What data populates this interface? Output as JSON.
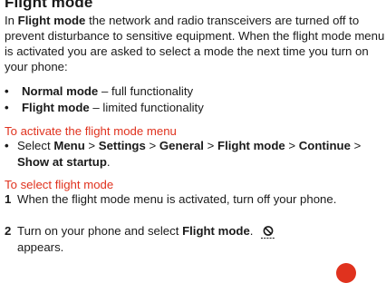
{
  "title": "Flight mode",
  "intro": {
    "p1_a": "In ",
    "p1_b": "Flight mode",
    "p1_c": " the network and radio transceivers are turned off to prevent disturbance to sensitive equipment. When the flight mode menu is activated you are asked to select a mode the next time you turn on your phone:"
  },
  "modes": [
    {
      "bullet": "•",
      "name": "Normal mode",
      "desc": " – full functionality"
    },
    {
      "bullet": "•",
      "name": "Flight mode",
      "desc": " – limited functionality"
    }
  ],
  "activate": {
    "heading": "To activate the flight mode menu",
    "bullet": "•",
    "pre": "Select ",
    "path": [
      {
        "label": "Menu",
        "sep": " > "
      },
      {
        "label": "Settings",
        "sep": " > "
      },
      {
        "label": "General",
        "sep": " > "
      },
      {
        "label": "Flight mode",
        "sep": " > "
      },
      {
        "label": "Continue",
        "sep": " > "
      },
      {
        "label": "Show at startup",
        "sep": "."
      }
    ]
  },
  "select": {
    "heading": "To select flight mode",
    "steps": [
      {
        "num": "1",
        "text": "When the flight mode menu is activated, turn off your phone."
      },
      {
        "num": "2",
        "pre": "Turn on your phone and select ",
        "bold": "Flight mode",
        "post": ".",
        "after_icon": "appears.",
        "icon": "flight-mode-icon"
      }
    ]
  },
  "colors": {
    "heading_red": "#e0321e",
    "text": "#1a1a1a",
    "corner_circle": "#e0321e"
  }
}
